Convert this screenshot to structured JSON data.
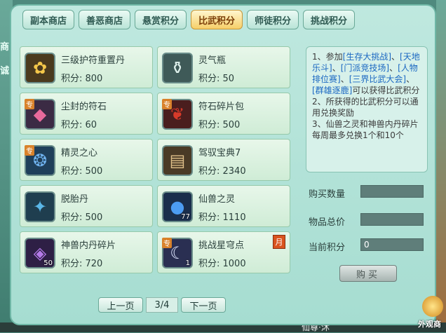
{
  "tabs": [
    {
      "label": "副本商店"
    },
    {
      "label": "善恶商店"
    },
    {
      "label": "悬赏积分"
    },
    {
      "label": "比武积分",
      "active": true
    },
    {
      "label": "师徒积分"
    },
    {
      "label": "挑战积分"
    }
  ],
  "items": [
    {
      "name": "三级护符重置丹",
      "points": "积分: 800",
      "icon": "gold-charm-icon",
      "glyph": "✿"
    },
    {
      "name": "灵气瓶",
      "points": "积分: 50",
      "icon": "spirit-bottle-icon",
      "glyph": "⚱"
    },
    {
      "name": "尘封的符石",
      "points": "积分: 60",
      "icon": "rune-stone-icon",
      "glyph": "◆",
      "tag": "专"
    },
    {
      "name": "符石碎片包",
      "points": "积分: 500",
      "icon": "rune-bag-icon",
      "glyph": "❦",
      "tag": "专"
    },
    {
      "name": "精灵之心",
      "points": "积分: 500",
      "icon": "spirit-heart-icon",
      "glyph": "❂",
      "tag": "专"
    },
    {
      "name": "驾驭宝典7",
      "points": "积分: 2340",
      "icon": "book-icon",
      "glyph": "▤"
    },
    {
      "name": "脱胎丹",
      "points": "积分: 500",
      "icon": "pill-icon",
      "glyph": "✦"
    },
    {
      "name": "仙兽之灵",
      "points": "积分: 1110",
      "icon": "orb-icon",
      "glyph": "●",
      "qty": "77"
    },
    {
      "name": "神兽内丹碎片",
      "points": "积分: 720",
      "icon": "crystal-icon",
      "glyph": "◈",
      "qty": "50"
    },
    {
      "name": "挑战星穹点",
      "points": "积分: 1000",
      "icon": "moon-icon",
      "glyph": "☾",
      "qty": "1",
      "tag": "专",
      "badge": "月"
    }
  ],
  "pager": {
    "prev": "上一页",
    "page": "3/4",
    "next": "下一页"
  },
  "desc": {
    "p1a": "1、参加",
    "p1b": "[生存大挑战]",
    "p1c": "、",
    "p1d": "[天地乐斗]",
    "p1e": "、",
    "p1f": "[门派竞技场]",
    "p1g": "、",
    "p1h": "[人物排位赛]",
    "p1i": "、",
    "p1j": "[三界比武大会]",
    "p1k": "、",
    "p1l": "[群雄逐鹿]",
    "p1m": "可以获得比武积分",
    "p2": "2、所获得的比武积分可以通用兑换奖励",
    "p3": "3、仙兽之灵和神兽内丹碎片每周最多兑换1个和10个"
  },
  "form": {
    "qty_label": "购买数量",
    "qty_value": "",
    "total_label": "物品总价",
    "total_value": "",
    "current_label": "当前积分",
    "current_value": "0",
    "buy_label": "购买"
  },
  "edge": {
    "left1": "商",
    "left2": "诚",
    "bottom": "仙尊·沐",
    "outlook": "外观商"
  }
}
